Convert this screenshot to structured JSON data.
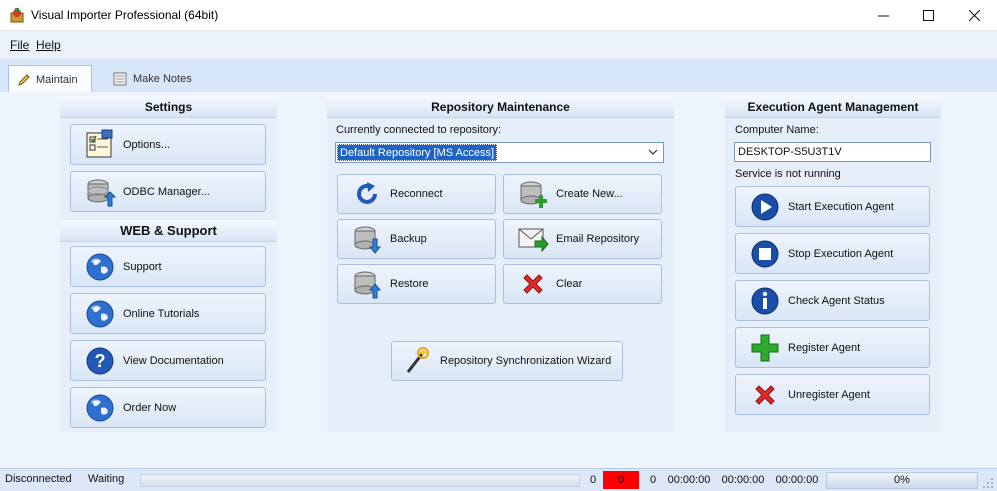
{
  "window": {
    "title": "Visual Importer Professional (64bit)",
    "controls": {
      "minimize": "—",
      "maximize": "☐",
      "close": "✕"
    }
  },
  "menu": {
    "file": "File",
    "help": "Help"
  },
  "tabs": [
    {
      "label": "Maintain",
      "icon": "pencil-icon",
      "active": true
    },
    {
      "label": "Make Notes",
      "icon": "notebook-icon",
      "active": false
    }
  ],
  "settings": {
    "header": "Settings",
    "buttons": [
      {
        "label": "Options...",
        "icon": "options-icon"
      },
      {
        "label": "ODBC Manager...",
        "icon": "database-icon"
      }
    ]
  },
  "web_support": {
    "header": "WEB & Support",
    "buttons": [
      {
        "label": "Support",
        "icon": "globe-icon"
      },
      {
        "label": "Online Tutorials",
        "icon": "globe-icon"
      },
      {
        "label": "View Documentation",
        "icon": "help-icon"
      },
      {
        "label": "Order Now",
        "icon": "globe-icon"
      }
    ]
  },
  "repository": {
    "header": "Repository Maintenance",
    "connected_label": "Currently connected to repository:",
    "selected_repository": "Default Repository  [MS Access]",
    "buttons": {
      "reconnect": "Reconnect",
      "create_new": "Create New...",
      "backup": "Backup",
      "email_repository": "Email Repository",
      "restore": "Restore",
      "clear": "Clear",
      "sync_wizard": "Repository Synchronization Wizard"
    }
  },
  "agent": {
    "header": "Execution Agent Management",
    "computer_name_label": "Computer Name:",
    "computer_name": "DESKTOP-S5U3T1V",
    "service_status": "Service is not running",
    "buttons": {
      "start": "Start Execution Agent",
      "stop": "Stop Execution Agent",
      "check": "Check Agent Status",
      "register": "Register Agent",
      "unregister": "Unregister Agent"
    }
  },
  "statusbar": {
    "connection": "Disconnected",
    "state": "Waiting",
    "count1": "0",
    "count2": "0",
    "count3": "0",
    "time1": "00:00:00",
    "time2": "00:00:00",
    "time3": "00:00:00",
    "progress_percent": "0%",
    "progress_value": 0
  },
  "colors": {
    "accent": "#1e64c8",
    "error_cell": "#ff0000",
    "panel_bg": "#e5eef9"
  }
}
